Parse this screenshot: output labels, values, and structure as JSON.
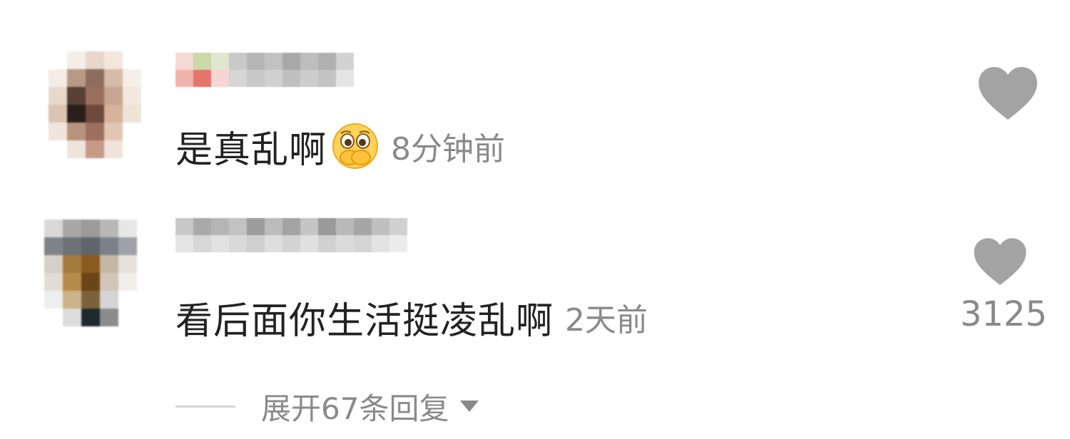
{
  "comments": [
    {
      "text": "是真乱啊",
      "emoji": "covering-mouth-pleading-emoji",
      "time": "8分钟前",
      "like_icon": "heart-icon"
    },
    {
      "text": "看后面你生活挺凌乱啊",
      "time": "2天前",
      "like_icon": "heart-icon",
      "like_count": "3125"
    }
  ],
  "expand": {
    "label": "展开67条回复",
    "icon": "caret-down-icon"
  },
  "colors": {
    "text": "#222222",
    "meta": "#8a8a8a",
    "heart": "#a3a3a3"
  }
}
